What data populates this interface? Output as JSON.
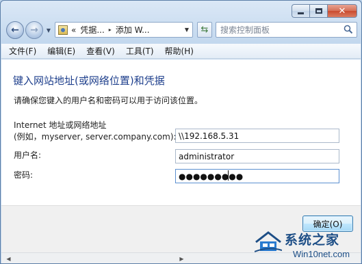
{
  "window": {
    "caption_buttons": {
      "minimize": "min-icon",
      "maximize": "max-icon",
      "close": "✕"
    }
  },
  "nav": {
    "back_icon": "arrow-left-icon",
    "forward_icon": "arrow-right-icon",
    "address": {
      "prefix": "«",
      "part1": "凭据...",
      "separator": "▸",
      "part2": "添加 W..."
    },
    "refresh_icon": "refresh-icon",
    "search_placeholder": "搜索控制面板"
  },
  "menu": {
    "file": "文件(F)",
    "edit": "编辑(E)",
    "view": "查看(V)",
    "tools": "工具(T)",
    "help": "帮助(H)"
  },
  "form": {
    "title": "键入网站地址(或网络位置)和凭据",
    "description": "请确保您键入的用户名和密码可以用于访问该位置。",
    "address_label_line1": "Internet 地址或网络地址",
    "address_label_line2": "(例如，myserver, server.company.com):",
    "address_value": "\\\\192.168.5.31",
    "username_label": "用户名:",
    "username_value": "administrator",
    "password_label": "密码:",
    "password_value": "●●●●●●●●●"
  },
  "buttons": {
    "ok": "确定(O)"
  },
  "watermark": {
    "title": "系统之家",
    "url": "Win10net.com"
  },
  "colors": {
    "title_blue": "#1e3f8c",
    "chrome_bg": "#c3d8ee",
    "close_red": "#c94a2e"
  }
}
